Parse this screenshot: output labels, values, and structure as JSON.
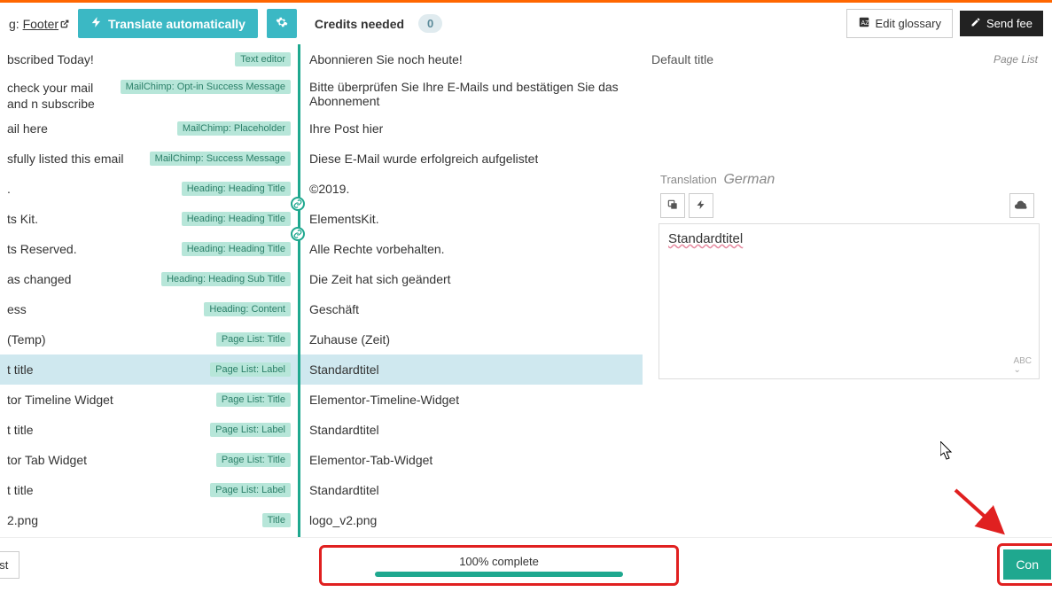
{
  "topbar": {
    "translating_prefix": "g:",
    "translating_link": "Footer",
    "translate_btn": "Translate automatically",
    "credits_label": "Credits needed",
    "credits_count": "0",
    "edit_glossary": "Edit glossary",
    "send_feedback": "Send fee"
  },
  "rows": [
    {
      "src": "bscribed Today!",
      "tag": "Text editor",
      "trg": "Abonnieren Sie noch heute!"
    },
    {
      "src": "check your mail and n subscribe",
      "tag": "MailChimp: Opt-in Success Message",
      "trg": "Bitte überprüfen Sie Ihre E-Mails und bestätigen Sie das Abonnement",
      "tall": true
    },
    {
      "src": "ail here",
      "tag": "MailChimp: Placeholder",
      "trg": "Ihre Post hier"
    },
    {
      "src": "sfully listed this email",
      "tag": "MailChimp: Success Message",
      "trg": "Diese E-Mail wurde erfolgreich aufgelistet"
    },
    {
      "src": ".",
      "tag": "Heading: Heading Title",
      "trg": "©2019.",
      "linkdot": true
    },
    {
      "src": "ts Kit.",
      "tag": "Heading: Heading Title",
      "trg": "ElementsKit.",
      "linkdot": true
    },
    {
      "src": "ts Reserved.",
      "tag": "Heading: Heading Title",
      "trg": "Alle Rechte vorbehalten."
    },
    {
      "src": "as changed",
      "tag": "Heading: Heading Sub Title",
      "trg": "Die Zeit hat sich geändert"
    },
    {
      "src": "ess",
      "tag": "Heading: Content",
      "trg": "Geschäft"
    },
    {
      "src": "(Temp)",
      "tag": "Page List: Title",
      "trg": "Zuhause (Zeit)"
    },
    {
      "src": "t title",
      "tag": "Page List: Label",
      "trg": "Standardtitel",
      "selected": true
    },
    {
      "src": "tor Timeline Widget",
      "tag": "Page List: Title",
      "trg": "Elementor-Timeline-Widget"
    },
    {
      "src": "t title",
      "tag": "Page List: Label",
      "trg": "Standardtitel"
    },
    {
      "src": "tor Tab Widget",
      "tag": "Page List: Title",
      "trg": "Elementor-Tab-Widget"
    },
    {
      "src": "t title",
      "tag": "Page List: Label",
      "trg": "Standardtitel"
    },
    {
      "src": "2.png",
      "tag": "Title",
      "trg": "logo_v2.png"
    }
  ],
  "right": {
    "header_title": "Default title",
    "header_tag": "Page List",
    "translation_label": "Translation",
    "translation_lang": "German",
    "translation_value": "Standardtitel"
  },
  "footer": {
    "back_btn": "to list",
    "progress_label": "100% complete",
    "complete_btn": "Con"
  }
}
